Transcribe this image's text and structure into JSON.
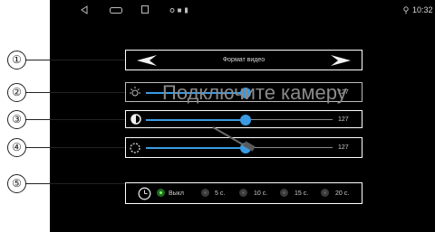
{
  "status_bar": {
    "time": "10:32",
    "icons": [
      "back-icon",
      "recents-icon",
      "home-icon",
      "notification-icons",
      "location-icon"
    ]
  },
  "callouts": [
    "①",
    "②",
    "③",
    "④",
    "⑤"
  ],
  "video_format": {
    "label": "Формат видео",
    "prev_icon": "arrow-left-icon",
    "next_icon": "arrow-right-icon"
  },
  "overlay": {
    "message": "Подключите камеру"
  },
  "sliders": [
    {
      "name": "brightness",
      "icon": "sun-icon",
      "value": "127",
      "level": 0.5
    },
    {
      "name": "contrast",
      "icon": "contrast-icon",
      "value": "127",
      "level": 0.5
    },
    {
      "name": "saturation",
      "icon": "dotted-circle-icon",
      "value": "127",
      "level": 0.5
    }
  ],
  "timer": {
    "icon": "clock-icon",
    "options": [
      "Выкл",
      "5 с.",
      "10 с.",
      "15 с.",
      "20 с."
    ],
    "selected": "Выкл"
  },
  "colors": {
    "accent": "#3a9be3",
    "selected": "#7dff5c",
    "background": "#000000"
  }
}
